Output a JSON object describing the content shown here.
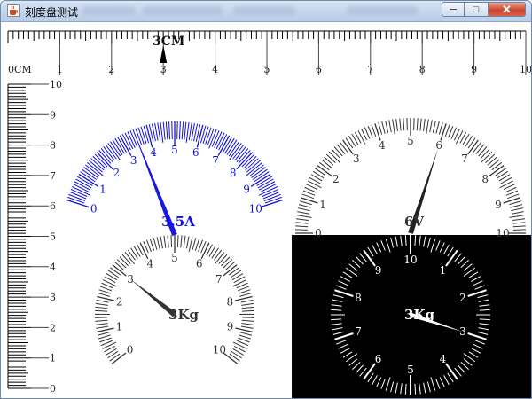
{
  "window": {
    "title": "刻度盘测试",
    "minimize_label": "─",
    "maximize_label": "□",
    "close_label": "✕",
    "icon": "java-cup-icon"
  },
  "top_ruler": {
    "unit_label": "0CM",
    "labels": [
      "1",
      "2",
      "3",
      "4",
      "5",
      "6",
      "7",
      "8",
      "9",
      "10"
    ],
    "value_text": "3CM",
    "value": 3
  },
  "left_ruler": {
    "labels": [
      "0",
      "1",
      "2",
      "3",
      "4",
      "5",
      "6",
      "7",
      "8",
      "9",
      "10"
    ]
  },
  "gauges": {
    "current": {
      "labels": [
        "0",
        "1",
        "2",
        "3",
        "4",
        "5",
        "6",
        "7",
        "8",
        "9",
        "10"
      ],
      "value_text": "3.5A",
      "value": 3.5,
      "color": "#1010dd"
    },
    "voltage": {
      "labels": [
        "0",
        "1",
        "2",
        "3",
        "4",
        "5",
        "6",
        "7",
        "8",
        "9",
        "10"
      ],
      "value_text": "6V",
      "value": 6,
      "color": "#333333"
    },
    "weight_white": {
      "labels": [
        "0",
        "1",
        "2",
        "3",
        "4",
        "5",
        "6",
        "7",
        "8",
        "9",
        "10"
      ],
      "value_text": "3Kg",
      "value": 3,
      "color": "#333333"
    },
    "weight_black": {
      "labels": [
        "1",
        "2",
        "3",
        "4",
        "5",
        "6",
        "7",
        "8",
        "9",
        "10"
      ],
      "value_text": "3Kg",
      "value": 3,
      "color": "#ffffff",
      "background": "#000000"
    }
  }
}
